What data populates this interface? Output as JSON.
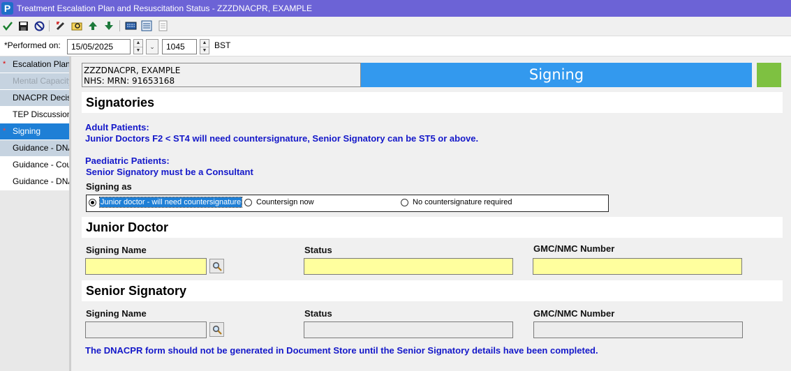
{
  "window": {
    "title": "Treatment Escalation Plan and Resuscitation Status - ZZZDNACPR, EXAMPLE",
    "app_icon_letter": "P"
  },
  "toolbar": {
    "icons": [
      "checkmark-icon",
      "save-icon",
      "cancel-icon",
      "edit-icon",
      "search-folder-icon",
      "up-arrow-icon",
      "down-arrow-icon",
      "keyboard-icon",
      "form-icon",
      "document-icon"
    ]
  },
  "performed": {
    "label": "*Performed on:",
    "date": "15/05/2025",
    "time": "1045",
    "timezone": "BST"
  },
  "sidebar": {
    "items": [
      {
        "label": "Escalation Plan",
        "state": "done",
        "marked": true
      },
      {
        "label": "Mental Capacity A",
        "state": "disabled",
        "marked": false
      },
      {
        "label": "DNACPR Decisio",
        "state": "done",
        "marked": false
      },
      {
        "label": "TEP Discussion",
        "state": "plain",
        "marked": false
      },
      {
        "label": "Signing",
        "state": "active",
        "marked": true
      },
      {
        "label": "Guidance - DNAC",
        "state": "done",
        "marked": false
      },
      {
        "label": "Guidance - Count",
        "state": "plain",
        "marked": false
      },
      {
        "label": "Guidance - DNAC",
        "state": "plain",
        "marked": false
      }
    ],
    "mark_symbol": "*"
  },
  "patient": {
    "name": "ZZZDNACPR, EXAMPLE",
    "ids": "NHS:  MRN: 91653168"
  },
  "banner": {
    "title": "Signing",
    "status_color": "#7ec141"
  },
  "signatories": {
    "heading": "Signatories",
    "adult_title": "Adult Patients:",
    "adult_text": "Junior Doctors F2 < ST4 will need countersignature, Senior Signatory can be ST5 or above.",
    "paed_title": "Paediatric Patients:",
    "paed_text": "Senior Signatory must be a Consultant",
    "signing_as_label": "Signing as",
    "options": [
      {
        "label": "Junior doctor - will need countersignature",
        "selected": true
      },
      {
        "label": "Countersign now",
        "selected": false
      },
      {
        "label": "No countersignature required",
        "selected": false
      }
    ]
  },
  "junior": {
    "heading": "Junior Doctor",
    "name_label": "Signing Name",
    "status_label": "Status",
    "gmc_label": "GMC/NMC Number",
    "name_value": "",
    "status_value": "",
    "gmc_value": ""
  },
  "senior": {
    "heading": "Senior Signatory",
    "name_label": "Signing Name",
    "status_label": "Status",
    "gmc_label": "GMC/NMC Number",
    "name_value": "",
    "status_value": "",
    "gmc_value": ""
  },
  "footer_note": "The DNACPR form should not be generated in Document Store until the Senior Signatory details have been completed.",
  "colors": {
    "titlebar": "#6c63d6",
    "banner": "#3399ee",
    "blue_text": "#1418c9",
    "required_field": "#ffff9e"
  }
}
